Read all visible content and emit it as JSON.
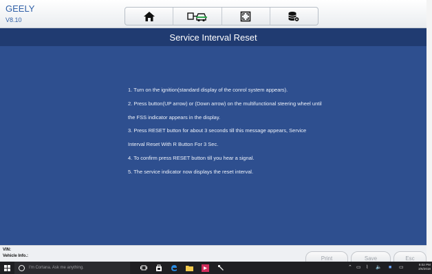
{
  "app": {
    "brand": "GEELY",
    "version": "V8.10"
  },
  "toolbar": {
    "icons": [
      "home-icon",
      "vehicle-connect-icon",
      "screenshot-icon",
      "database-settings-icon"
    ]
  },
  "page": {
    "title": "Service Interval Reset"
  },
  "instructions": [
    "1. Turn on the ignition(standard display of the conrol system appears).",
    "2. Press button(UP arrow) or (Down arrow) on the multifunctional steering wheel until",
    "the FSS indicator appears in the display.",
    "3. Press RESET button for about 3 seconds till this message appears, Service",
    "Interval Reset With R Button For 3 Sec.",
    "4. To confirm press RESET button till you hear a signal.",
    "5. The service indicator now displays the reset interval."
  ],
  "footer": {
    "vin_label": "VIN:",
    "vehicle_info_label": "Vehicle Info.:",
    "print": "Print",
    "save": "Save",
    "esc": "Esc"
  },
  "taskbar": {
    "search_placeholder": "I'm Cortana. Ask me anything.",
    "time": "8:02 PM",
    "date": "3/6/2018"
  },
  "colors": {
    "title_bar": "#203b71",
    "content_bg": "#2e4f8f",
    "brand": "#2f5fa7"
  }
}
